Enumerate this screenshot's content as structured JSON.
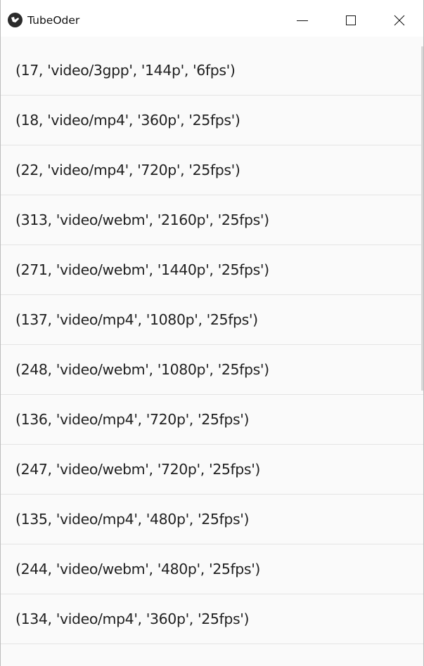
{
  "window": {
    "title": "TubeOder",
    "icon": "kivy-logo-icon"
  },
  "controls": {
    "minimize": "minimize-icon",
    "maximize": "maximize-icon",
    "close": "close-icon"
  },
  "streams": [
    {
      "label": "(17, 'video/3gpp', '144p', '6fps')"
    },
    {
      "label": "(18, 'video/mp4', '360p', '25fps')"
    },
    {
      "label": "(22, 'video/mp4', '720p', '25fps')"
    },
    {
      "label": "(313, 'video/webm', '2160p', '25fps')"
    },
    {
      "label": "(271, 'video/webm', '1440p', '25fps')"
    },
    {
      "label": "(137, 'video/mp4', '1080p', '25fps')"
    },
    {
      "label": "(248, 'video/webm', '1080p', '25fps')"
    },
    {
      "label": "(136, 'video/mp4', '720p', '25fps')"
    },
    {
      "label": "(247, 'video/webm', '720p', '25fps')"
    },
    {
      "label": "(135, 'video/mp4', '480p', '25fps')"
    },
    {
      "label": "(244, 'video/webm', '480p', '25fps')"
    },
    {
      "label": "(134, 'video/mp4', '360p', '25fps')"
    }
  ]
}
